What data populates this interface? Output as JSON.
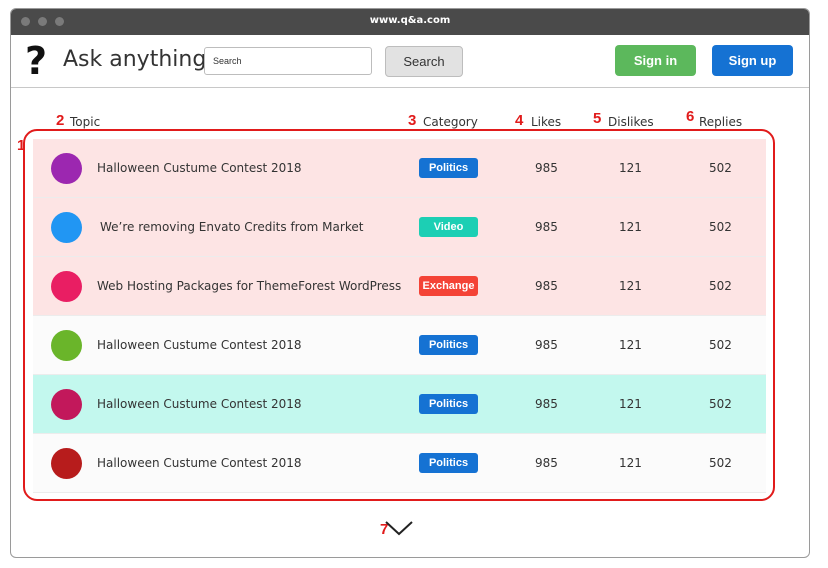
{
  "window": {
    "url": "www.q&a.com"
  },
  "header": {
    "logo": "?",
    "brand": "Ask anything",
    "search_placeholder": "Search",
    "search_button": "Search",
    "signin": "Sign in",
    "signup": "Sign up",
    "colors": {
      "signin": "#5cb85c",
      "signup": "#1572d3"
    }
  },
  "annotations": [
    "1",
    "2",
    "3",
    "4",
    "5",
    "6",
    "7"
  ],
  "columns": {
    "topic": "Topic",
    "category": "Category",
    "likes": "Likes",
    "dislikes": "Dislikes",
    "replies": "Replies"
  },
  "rows": [
    {
      "topic": "Halloween Custume Contest 2018",
      "category": "Politics",
      "likes": "985",
      "dislikes": "121",
      "replies": "502",
      "avatar_color": "#9c27b0",
      "badge_color": "#1572d3",
      "row_bg": "#fde4e4"
    },
    {
      "topic": "We’re removing Envato Credits from Market",
      "category": "Video",
      "likes": "985",
      "dislikes": "121",
      "replies": "502",
      "avatar_color": "#2196f3",
      "badge_color": "#1ccfb4",
      "row_bg": "#fde4e4"
    },
    {
      "topic": "Web Hosting Packages for ThemeForest WordPress",
      "category": "Exchange",
      "likes": "985",
      "dislikes": "121",
      "replies": "502",
      "avatar_color": "#e91e63",
      "badge_color": "#f44336",
      "row_bg": "#fde4e4"
    },
    {
      "topic": "Halloween Custume Contest 2018",
      "category": "Politics",
      "likes": "985",
      "dislikes": "121",
      "replies": "502",
      "avatar_color": "#6ab52a",
      "badge_color": "#1572d3",
      "row_bg": "#fbfbfb"
    },
    {
      "topic": "Halloween Custume Contest 2018",
      "category": "Politics",
      "likes": "985",
      "dislikes": "121",
      "replies": "502",
      "avatar_color": "#c2185b",
      "badge_color": "#1572d3",
      "row_bg": "#c3f8ee"
    },
    {
      "topic": "Halloween Custume Contest 2018",
      "category": "Politics",
      "likes": "985",
      "dislikes": "121",
      "replies": "502",
      "avatar_color": "#b71c1c",
      "badge_color": "#1572d3",
      "row_bg": "#fbfbfb"
    }
  ],
  "more": {
    "icon": "chevron-down-icon"
  }
}
